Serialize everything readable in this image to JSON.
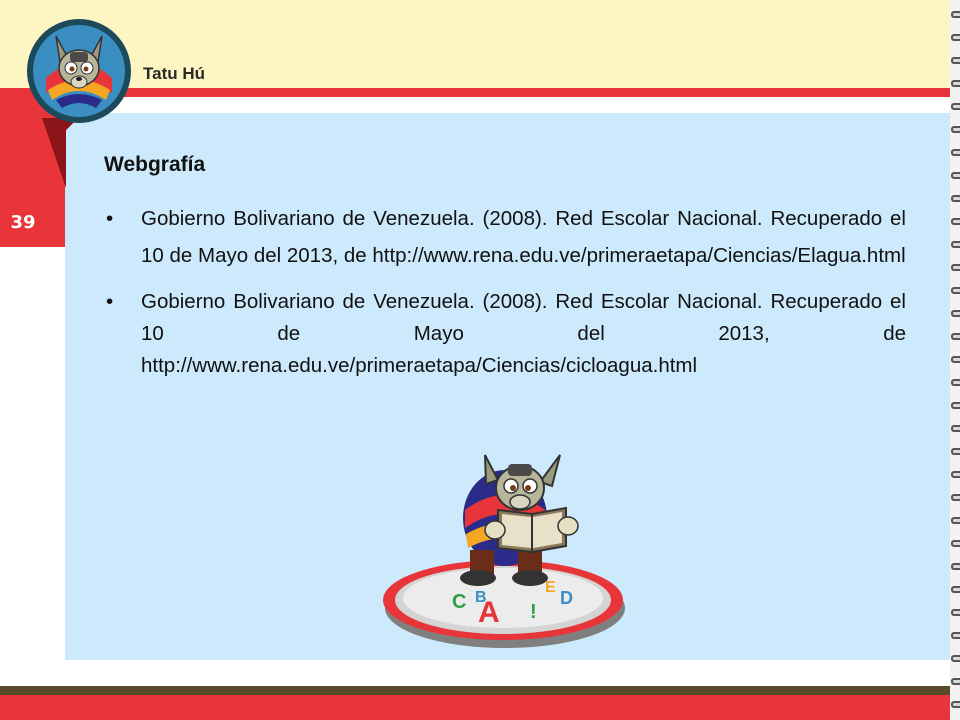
{
  "brand": {
    "name": "Tatu Hú"
  },
  "page": {
    "number": "39"
  },
  "section": {
    "heading": "Webgrafía"
  },
  "references": [
    {
      "bullet": "•",
      "text": "Gobierno Bolivariano de Venezuela. (2008). Red Escolar Nacional. Recuperado el 10 de Mayo del 2013, de http://www.rena.edu.ve/primeraetapa/Ciencias/Elagua.html"
    },
    {
      "bullet": "•",
      "text": "Gobierno Bolivariano de Venezuela. (2008). Red Escolar Nacional. Recuperado el 10 de Mayo del 2013, de http://www.rena.edu.ve/primeraetapa/Ciencias/cicloagua.html"
    }
  ],
  "illustration": {
    "description_icon": "armadillo-reading-book-icon",
    "platform_letters": [
      "C",
      "B",
      "D",
      "E",
      "A",
      "!"
    ]
  },
  "colors": {
    "accent_red": "#e8353a",
    "panel_blue": "#cdeafc",
    "header_cream": "#fdf6c3",
    "footer_brown": "#5b4a2a"
  }
}
